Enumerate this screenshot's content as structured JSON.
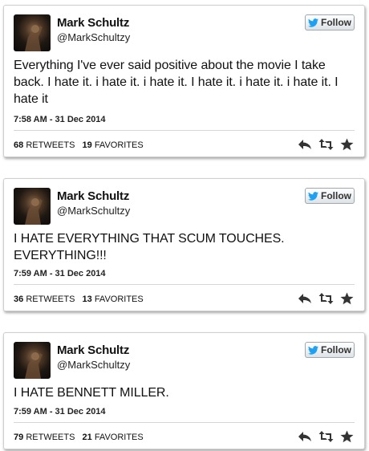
{
  "tweets": [
    {
      "name": "Mark Schultz",
      "handle": "@MarkSchultzy",
      "follow_label": "Follow",
      "text": "Everything I've ever said positive about the movie I take back. I hate it. i hate it. i hate it.  I hate it. i hate it. i hate it. I hate it",
      "timestamp": "7:58 AM - 31 Dec 2014",
      "retweets": "68",
      "retweets_label": "RETWEETS",
      "favorites": "19",
      "favorites_label": "FAVORITES"
    },
    {
      "name": "Mark Schultz",
      "handle": "@MarkSchultzy",
      "follow_label": "Follow",
      "text": "I HATE EVERYTHING THAT SCUM TOUCHES. EVERYTHING!!!",
      "timestamp": "7:59 AM - 31 Dec 2014",
      "retweets": "36",
      "retweets_label": "RETWEETS",
      "favorites": "13",
      "favorites_label": "FAVORITES"
    },
    {
      "name": "Mark Schultz",
      "handle": "@MarkSchultzy",
      "follow_label": "Follow",
      "text": "I HATE BENNETT MILLER.",
      "timestamp": "7:59 AM - 31 Dec 2014",
      "retweets": "79",
      "retweets_label": "RETWEETS",
      "favorites": "21",
      "favorites_label": "FAVORITES"
    }
  ],
  "icons": {
    "follow": "twitter-bird-icon",
    "reply": "reply-icon",
    "retweet": "retweet-icon",
    "favorite": "star-icon"
  },
  "colors": {
    "twitter_blue": "#1da1f2",
    "action_gray": "#333333"
  }
}
